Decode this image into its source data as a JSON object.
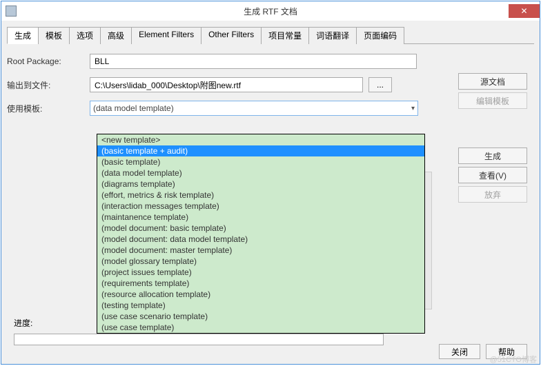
{
  "title": "生成 RTF 文档",
  "tabs": [
    "生成",
    "模板",
    "选项",
    "高级",
    "Element Filters",
    "Other Filters",
    "项目常量",
    "词语翻译",
    "页面编码"
  ],
  "active_tab": 0,
  "labels": {
    "root_package": "Root Package:",
    "output_file": "输出到文件:",
    "use_template": "使用模板:",
    "progress": "进度:"
  },
  "root_package_value": "BLL",
  "output_file_value": "C:\\Users\\lidab_000\\Desktop\\附图new.rtf",
  "browse_label": "...",
  "combo_selected": "(data model template)",
  "dropdown_items": [
    "<new template>",
    "(basic template + audit)",
    "(basic template)",
    "(data model template)",
    "(diagrams template)",
    "(effort, metrics & risk template)",
    "(interaction messages template)",
    "(maintanence template)",
    "(model document: basic template)",
    "(model document: data model template)",
    "(model document: master template)",
    "(model glossary template)",
    "(project issues template)",
    "(requirements template)",
    "(resource allocation template)",
    "(testing template)",
    "(use case scenario template)",
    "(use case template)"
  ],
  "dropdown_selected_index": 1,
  "buttons": {
    "source_doc": "源文档",
    "edit_template": "编辑模板",
    "generate": "生成",
    "view": "查看(V)",
    "abort": "放弃",
    "close": "关闭",
    "help": "帮助"
  },
  "watermark": "@51CTO博客"
}
